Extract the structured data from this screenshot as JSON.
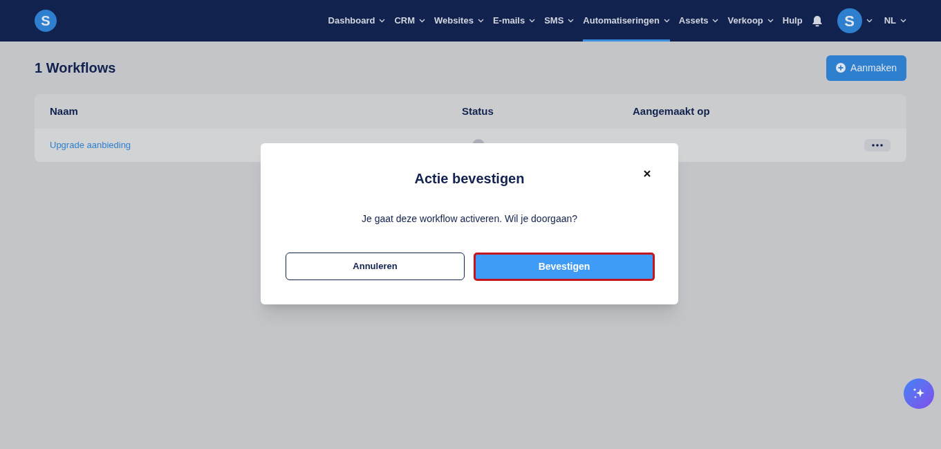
{
  "logo": {
    "letter": "S"
  },
  "nav": [
    {
      "label": "Dashboard",
      "dropdown": true,
      "selected": false
    },
    {
      "label": "CRM",
      "dropdown": true,
      "selected": false
    },
    {
      "label": "Websites",
      "dropdown": true,
      "selected": false
    },
    {
      "label": "E-mails",
      "dropdown": true,
      "selected": false
    },
    {
      "label": "SMS",
      "dropdown": true,
      "selected": false
    },
    {
      "label": "Automatiseringen",
      "dropdown": true,
      "selected": true
    },
    {
      "label": "Assets",
      "dropdown": true,
      "selected": false
    },
    {
      "label": "Verkoop",
      "dropdown": true,
      "selected": false
    },
    {
      "label": "Hulp",
      "dropdown": false,
      "selected": false
    }
  ],
  "user": {
    "avatar_letter": "S",
    "language": "NL"
  },
  "page_title": "1 Workflows",
  "create_button": "Aanmaken",
  "table": {
    "columns": [
      "Naam",
      "Status",
      "Aangemaakt op"
    ],
    "rows": [
      {
        "name": "Upgrade aanbieding"
      }
    ]
  },
  "dialog": {
    "title": "Actie bevestigen",
    "message": "Je gaat deze workflow activeren. Wil je doorgaan?",
    "cancel": "Annuleren",
    "confirm": "Bevestigen"
  }
}
